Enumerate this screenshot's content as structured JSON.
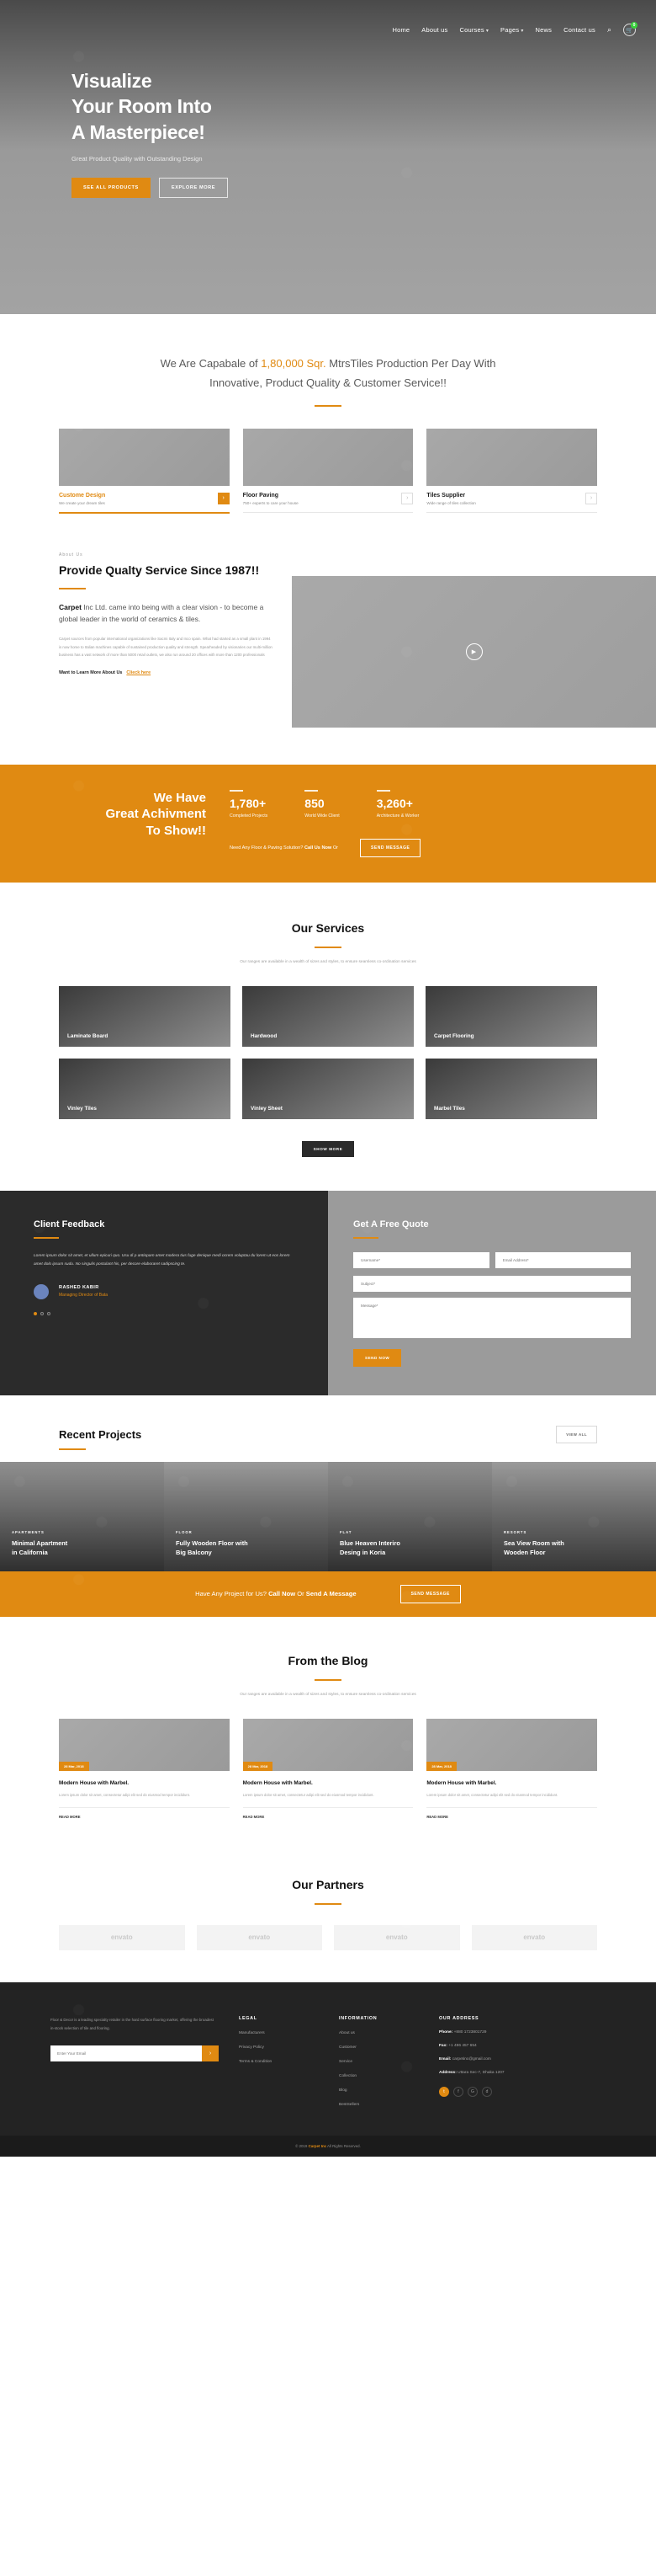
{
  "nav": {
    "items": [
      {
        "label": "Home",
        "caret": false
      },
      {
        "label": "About us",
        "caret": false
      },
      {
        "label": "Courses",
        "caret": true
      },
      {
        "label": "Pages",
        "caret": true
      },
      {
        "label": "News",
        "caret": false
      },
      {
        "label": "Contact us",
        "caret": false
      }
    ],
    "search_icon": "search-icon",
    "cart_icon": "cart-icon",
    "cart_count": "0"
  },
  "hero": {
    "title_line1": "Visualize",
    "title_line2": "Your Room Into",
    "title_line3": "A Masterpiece!",
    "subtitle": "Great Product Quality with Outstanding Design",
    "btn_primary": "SEE ALL PRODUCTS",
    "btn_secondary": "EXPLORE MORE"
  },
  "capability": {
    "pre": "We Are Capabale of ",
    "highlight": "1,80,000 Sqr.",
    "post": " MtrsTiles Production Per Day With Innovative, Product Quality & Customer Service!!"
  },
  "features": [
    {
      "title": "Custome Design",
      "desc": "We create your dream tiles",
      "arrow": "chevron-right-icon",
      "active": true
    },
    {
      "title": "Floor Paving",
      "desc": "750+ experts to care your house",
      "arrow": "chevron-right-icon",
      "active": false
    },
    {
      "title": "Tiles Supplier",
      "desc": "Wide range of tiles collection",
      "arrow": "chevron-right-icon",
      "active": false
    }
  ],
  "about": {
    "kicker": "About Us",
    "title": "Provide Qualty Service Since 1987!!",
    "lead_bold": "Carpet",
    "lead": " Inc Ltd. came into being with a clear vision - to become a global leader in the world of ceramics & tiles.",
    "paragraph": "Carpet sources from popular international organizations like Sacmi Italy and Inco spain. What had started as a small plant in 1994 is now home to Italian machines capable of sustained production quality and strength. Spearheaded by visionaries our multi-million business has a vast network of more than 5000 retail outlets, we also run around 20 offices with more than 1200 professionals",
    "more_text": "Want to Learn More About Us",
    "more_link": "Clieck here",
    "play_icon": "play-icon"
  },
  "achievement": {
    "heading_l1": "We Have",
    "heading_l2": "Great Achivment",
    "heading_l3": "To Show!!",
    "stats": [
      {
        "number": "1,780+",
        "label": "Completed Projects"
      },
      {
        "number": "850",
        "label": "World Wide Client"
      },
      {
        "number": "3,260+",
        "label": "Architecture & Worker"
      }
    ],
    "cta_pre": "Need Any Floor & Paving Solution? ",
    "cta_bold": "Call Us Now",
    "cta_post": " Or",
    "cta_button": "SEND MESSAGE"
  },
  "services": {
    "title": "Our Services",
    "subtitle": "Our ranges are available in a wealth of sizes and styles, to ensure seamless co-ordination services",
    "items": [
      "Laminate Board",
      "Hardwood",
      "Carpet Flooring",
      "Vinley Tiles",
      "Vinley Sheet",
      "Marbel Tiles"
    ],
    "show_more": "SHOW MORE"
  },
  "feedback": {
    "title": "Client Feedback",
    "quote": "Lorem ipsum dolor sit amet, et ullum epicuri quo. Usu di p antiopam amet modera tius fuge denique medi ocrem voluptau du lorem ut eos lorem amet dolo ipsum sudu. No singulis postulant his, per decore elaboraret sadipscing te.",
    "author": "RASHED KABIR",
    "role": "Managing Director of  Bata"
  },
  "quote_form": {
    "title": "Get A Free Quote",
    "username_placeholder": "Username*",
    "email_placeholder": "Email Address*",
    "subject_placeholder": "Subject*",
    "message_placeholder": "Message*",
    "submit": "SEND NOW"
  },
  "recent_projects": {
    "title": "Recent Projects",
    "view_all": "VIEW ALL",
    "items": [
      {
        "category": "APARTMENTS",
        "title_l1": "Minimal Apartment",
        "title_l2": "in California"
      },
      {
        "category": "FLOOR",
        "title_l1": "Fully Wooden Floor with",
        "title_l2": "Big Balcony"
      },
      {
        "category": "FLAT",
        "title_l1": "Blue Heaven Interiro",
        "title_l2": "Desing in Koria"
      },
      {
        "category": "RESORTS",
        "title_l1": "Sea View Room with",
        "title_l2": "Wooden Floor"
      }
    ]
  },
  "cta_band": {
    "pre": "Have Any Project for Us? ",
    "bold1": "Call Now",
    "mid": " Or ",
    "bold2": "Send A Message",
    "button": "SEND MESSAGE"
  },
  "blog": {
    "title": "From the Blog",
    "subtitle": "Our ranges are available in a wealth of sizes and styles, to ensure seamless co-ordination services",
    "posts": [
      {
        "date": "28 Mar, 2018",
        "title": "Modern House with Marbel.",
        "excerpt": "Lorem ipsum dolor sit amet, consectetur adipi elit sed do eiusmod tempor incididunt.",
        "more": "READ MORE"
      },
      {
        "date": "28 Mar, 2018",
        "title": "Modern House with Marbel.",
        "excerpt": "Lorem ipsum dolor sit amet, consectetur adipi elit sed do eiusmod tempor incididunt.",
        "more": "READ MORE"
      },
      {
        "date": "28 Mar, 2018",
        "title": "Modern House with Marbel.",
        "excerpt": "Lorem ipsum dolor sit amet, consectetur adipi elit sed do eiusmod tempor incididunt.",
        "more": "READ MORE"
      }
    ]
  },
  "partners": {
    "title": "Our Partners",
    "logos": [
      "envato",
      "envato",
      "envato",
      "envato"
    ]
  },
  "footer": {
    "description": "Floor & Decor is a leading specialty retailer in the hard surface flooring market, offering the broadest in-stock selection of tile and flooring.",
    "email_placeholder": "Enter Your Email",
    "submit_icon": "chevron-right-icon",
    "legal_heading": "LEGAL",
    "legal_links": [
      "Manufacturers",
      "Privacy Policy",
      "Terms & Condition"
    ],
    "info_heading": "INFORMATION",
    "info_links": [
      "About us",
      "Customer",
      "Service",
      "Collection",
      "Blog",
      "BestSellers"
    ],
    "address_heading": "OUR ADDRESS",
    "phone_label": "Phone:",
    "phone": " +880 1723801729",
    "fax_label": "Fax:",
    "fax": " +1 496 457 654",
    "email_label": "Email:",
    "email": " carpetinc@gmail.com",
    "address_label": "Address:",
    "address": " Uttara Sec-7, Dhaka 1207",
    "social": [
      "twitter-icon",
      "facebook-icon",
      "google-plus-icon",
      "dribbble-icon"
    ]
  },
  "copyright": {
    "pre": "© 2019 ",
    "brand": "Carpet Inc",
    "post": " All Rights Reserved."
  }
}
